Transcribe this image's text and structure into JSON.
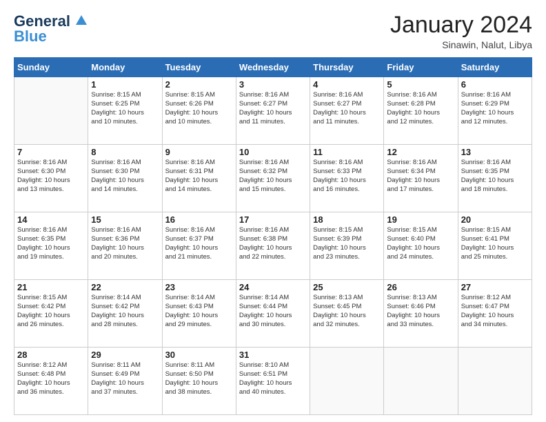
{
  "logo": {
    "line1": "General",
    "line2": "Blue"
  },
  "title": "January 2024",
  "subtitle": "Sinawin, Nalut, Libya",
  "days_header": [
    "Sunday",
    "Monday",
    "Tuesday",
    "Wednesday",
    "Thursday",
    "Friday",
    "Saturday"
  ],
  "weeks": [
    [
      {
        "num": "",
        "info": ""
      },
      {
        "num": "1",
        "info": "Sunrise: 8:15 AM\nSunset: 6:25 PM\nDaylight: 10 hours\nand 10 minutes."
      },
      {
        "num": "2",
        "info": "Sunrise: 8:15 AM\nSunset: 6:26 PM\nDaylight: 10 hours\nand 10 minutes."
      },
      {
        "num": "3",
        "info": "Sunrise: 8:16 AM\nSunset: 6:27 PM\nDaylight: 10 hours\nand 11 minutes."
      },
      {
        "num": "4",
        "info": "Sunrise: 8:16 AM\nSunset: 6:27 PM\nDaylight: 10 hours\nand 11 minutes."
      },
      {
        "num": "5",
        "info": "Sunrise: 8:16 AM\nSunset: 6:28 PM\nDaylight: 10 hours\nand 12 minutes."
      },
      {
        "num": "6",
        "info": "Sunrise: 8:16 AM\nSunset: 6:29 PM\nDaylight: 10 hours\nand 12 minutes."
      }
    ],
    [
      {
        "num": "7",
        "info": "Sunrise: 8:16 AM\nSunset: 6:30 PM\nDaylight: 10 hours\nand 13 minutes."
      },
      {
        "num": "8",
        "info": "Sunrise: 8:16 AM\nSunset: 6:30 PM\nDaylight: 10 hours\nand 14 minutes."
      },
      {
        "num": "9",
        "info": "Sunrise: 8:16 AM\nSunset: 6:31 PM\nDaylight: 10 hours\nand 14 minutes."
      },
      {
        "num": "10",
        "info": "Sunrise: 8:16 AM\nSunset: 6:32 PM\nDaylight: 10 hours\nand 15 minutes."
      },
      {
        "num": "11",
        "info": "Sunrise: 8:16 AM\nSunset: 6:33 PM\nDaylight: 10 hours\nand 16 minutes."
      },
      {
        "num": "12",
        "info": "Sunrise: 8:16 AM\nSunset: 6:34 PM\nDaylight: 10 hours\nand 17 minutes."
      },
      {
        "num": "13",
        "info": "Sunrise: 8:16 AM\nSunset: 6:35 PM\nDaylight: 10 hours\nand 18 minutes."
      }
    ],
    [
      {
        "num": "14",
        "info": "Sunrise: 8:16 AM\nSunset: 6:35 PM\nDaylight: 10 hours\nand 19 minutes."
      },
      {
        "num": "15",
        "info": "Sunrise: 8:16 AM\nSunset: 6:36 PM\nDaylight: 10 hours\nand 20 minutes."
      },
      {
        "num": "16",
        "info": "Sunrise: 8:16 AM\nSunset: 6:37 PM\nDaylight: 10 hours\nand 21 minutes."
      },
      {
        "num": "17",
        "info": "Sunrise: 8:16 AM\nSunset: 6:38 PM\nDaylight: 10 hours\nand 22 minutes."
      },
      {
        "num": "18",
        "info": "Sunrise: 8:15 AM\nSunset: 6:39 PM\nDaylight: 10 hours\nand 23 minutes."
      },
      {
        "num": "19",
        "info": "Sunrise: 8:15 AM\nSunset: 6:40 PM\nDaylight: 10 hours\nand 24 minutes."
      },
      {
        "num": "20",
        "info": "Sunrise: 8:15 AM\nSunset: 6:41 PM\nDaylight: 10 hours\nand 25 minutes."
      }
    ],
    [
      {
        "num": "21",
        "info": "Sunrise: 8:15 AM\nSunset: 6:42 PM\nDaylight: 10 hours\nand 26 minutes."
      },
      {
        "num": "22",
        "info": "Sunrise: 8:14 AM\nSunset: 6:42 PM\nDaylight: 10 hours\nand 28 minutes."
      },
      {
        "num": "23",
        "info": "Sunrise: 8:14 AM\nSunset: 6:43 PM\nDaylight: 10 hours\nand 29 minutes."
      },
      {
        "num": "24",
        "info": "Sunrise: 8:14 AM\nSunset: 6:44 PM\nDaylight: 10 hours\nand 30 minutes."
      },
      {
        "num": "25",
        "info": "Sunrise: 8:13 AM\nSunset: 6:45 PM\nDaylight: 10 hours\nand 32 minutes."
      },
      {
        "num": "26",
        "info": "Sunrise: 8:13 AM\nSunset: 6:46 PM\nDaylight: 10 hours\nand 33 minutes."
      },
      {
        "num": "27",
        "info": "Sunrise: 8:12 AM\nSunset: 6:47 PM\nDaylight: 10 hours\nand 34 minutes."
      }
    ],
    [
      {
        "num": "28",
        "info": "Sunrise: 8:12 AM\nSunset: 6:48 PM\nDaylight: 10 hours\nand 36 minutes."
      },
      {
        "num": "29",
        "info": "Sunrise: 8:11 AM\nSunset: 6:49 PM\nDaylight: 10 hours\nand 37 minutes."
      },
      {
        "num": "30",
        "info": "Sunrise: 8:11 AM\nSunset: 6:50 PM\nDaylight: 10 hours\nand 38 minutes."
      },
      {
        "num": "31",
        "info": "Sunrise: 8:10 AM\nSunset: 6:51 PM\nDaylight: 10 hours\nand 40 minutes."
      },
      {
        "num": "",
        "info": ""
      },
      {
        "num": "",
        "info": ""
      },
      {
        "num": "",
        "info": ""
      }
    ]
  ]
}
